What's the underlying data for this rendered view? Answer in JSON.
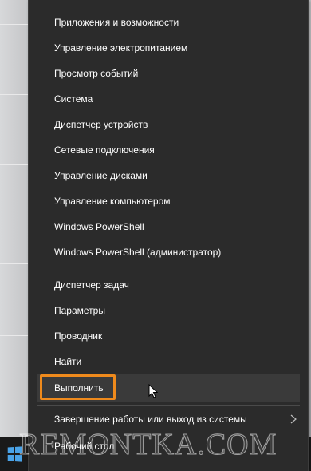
{
  "menu": {
    "items_group1": [
      {
        "label": "Приложения и возможности"
      },
      {
        "label": "Управление электропитанием"
      },
      {
        "label": "Просмотр событий"
      },
      {
        "label": "Система"
      },
      {
        "label": "Диспетчер устройств"
      },
      {
        "label": "Сетевые подключения"
      },
      {
        "label": "Управление дисками"
      },
      {
        "label": "Управление компьютером"
      },
      {
        "label": "Windows PowerShell"
      },
      {
        "label": "Windows PowerShell (администратор)"
      }
    ],
    "items_group2": [
      {
        "label": "Диспетчер задач"
      },
      {
        "label": "Параметры"
      },
      {
        "label": "Проводник"
      },
      {
        "label": "Найти"
      },
      {
        "label": "Выполнить"
      }
    ],
    "items_group3": [
      {
        "label": "Завершение работы или выход из системы"
      },
      {
        "label": "Рабочий стол"
      }
    ],
    "highlighted_item": "Выполнить",
    "highlight_color": "#ef8a1c"
  },
  "watermark": "REMONTKA.COM",
  "colors": {
    "menu_bg": "#2b2b2b",
    "menu_text": "#ffffff",
    "windows_logo": "#4aa3e8"
  }
}
